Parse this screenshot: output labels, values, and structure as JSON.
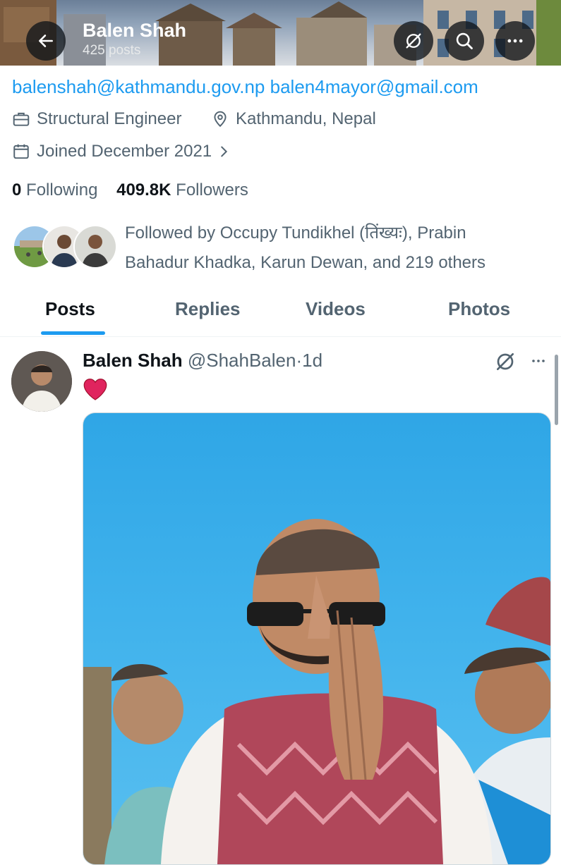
{
  "header": {
    "name": "Balen Shah",
    "posts_count": "425 posts"
  },
  "profile": {
    "link_email_1": "balenshah@kathmandu.gov.np",
    "link_email_2": "balen4mayor@gmail.com",
    "profession": "Structural Engineer",
    "location": "Kathmandu, Nepal",
    "joined": "Joined December 2021",
    "following_count": "0",
    "following_label": "Following",
    "followers_count": "409.8K",
    "followers_label": "Followers",
    "followed_by_line1": "Followed by Occupy Tundikhel (तिंख्यः), Prabin",
    "followed_by_line2": "Bahadur Khadka, Karun Dewan, and 219 others"
  },
  "tabs": [
    "Posts",
    "Replies",
    "Videos",
    "Photos"
  ],
  "active_tab": "Posts",
  "post": {
    "author": "Balen Shah",
    "handle": "@ShahBalen",
    "separator": "·",
    "time": "1d",
    "content_emoji": "red-heart"
  },
  "colors": {
    "accent": "#1d9bf0",
    "text": "#0f1419",
    "muted": "#536471",
    "heart": "#e0245e"
  },
  "icons": [
    "back-arrow-icon",
    "grok-icon",
    "search-icon",
    "more-icon",
    "briefcase-icon",
    "location-pin-icon",
    "calendar-icon",
    "chevron-right-icon"
  ]
}
